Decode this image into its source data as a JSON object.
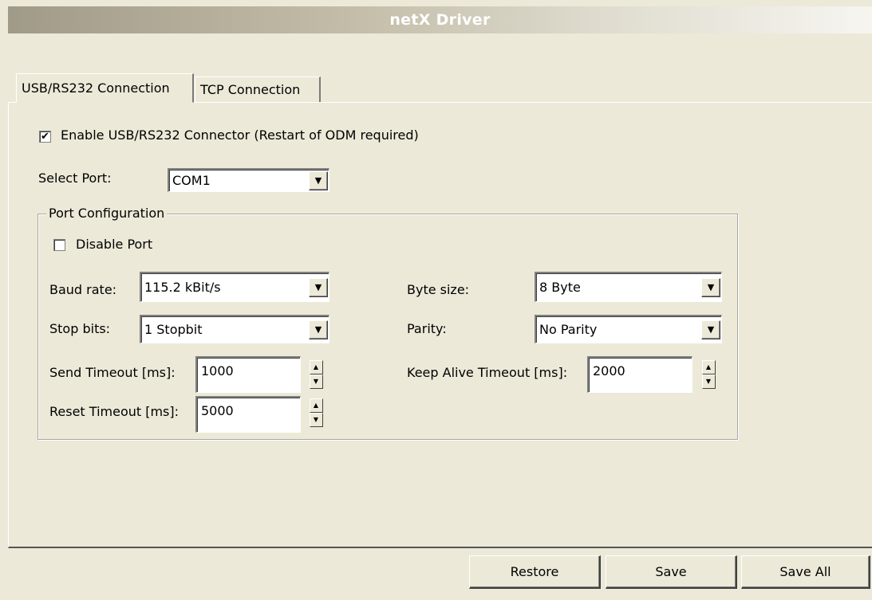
{
  "window": {
    "title": "netX Driver"
  },
  "tabs": [
    {
      "label": "USB/RS232 Connection",
      "active": true
    },
    {
      "label": "TCP Connection",
      "active": false
    }
  ],
  "usb": {
    "enable_label": "Enable USB/RS232 Connector (Restart of ODM required)",
    "enable_checked": true,
    "check_glyph": "✔",
    "select_port_label": "Select Port:",
    "select_port_value": "COM1",
    "port_config": {
      "legend": "Port Configuration",
      "disable_label": "Disable Port",
      "disable_checked": false,
      "baud_label": "Baud rate:",
      "baud_value": "115.2  kBit/s",
      "stop_label": "Stop bits:",
      "stop_value": "1 Stopbit",
      "byte_label": "Byte size:",
      "byte_value": "8 Byte",
      "parity_label": "Parity:",
      "parity_value": "No Parity",
      "send_timeout_label": "Send Timeout [ms]:",
      "send_timeout_value": "1000",
      "reset_timeout_label": "Reset Timeout [ms]:",
      "reset_timeout_value": "5000",
      "keepalive_label": "Keep Alive Timeout [ms]:",
      "keepalive_value": "2000"
    }
  },
  "footer": {
    "restore_label": "Restore",
    "save_label": "Save",
    "save_all_label": "Save All"
  },
  "icons": {
    "dropdown": "▼",
    "spin_up": "▲",
    "spin_down": "▼"
  },
  "colors": {
    "face": "#ece9d8",
    "title_text": "#ffffff"
  }
}
